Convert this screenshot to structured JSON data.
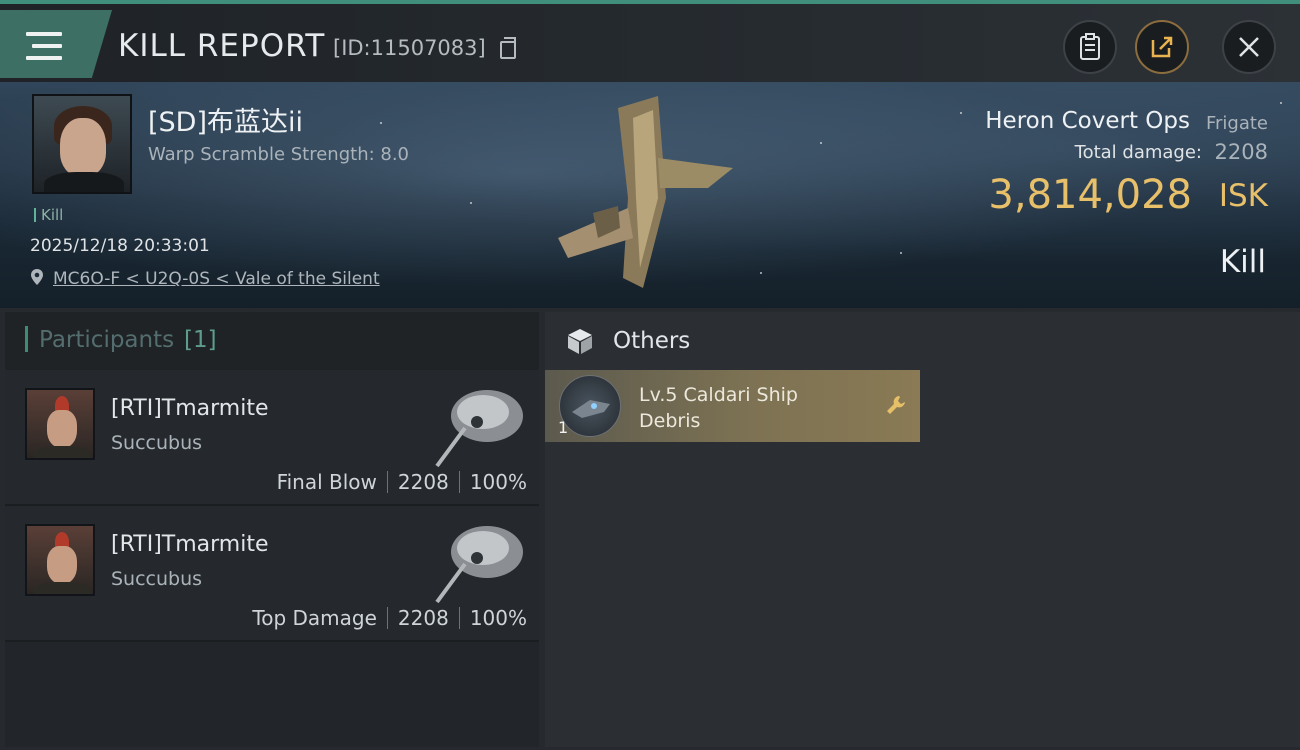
{
  "header": {
    "title": "KILL REPORT",
    "report_id": "[ID:11507083]",
    "menu_icon": "menu-icon",
    "buttons": [
      "clipboard-icon",
      "share-icon",
      "close-icon"
    ]
  },
  "victim": {
    "name": "[SD]布蓝达ii",
    "warp_scramble": "Warp Scramble Strength: 8.0",
    "result_tag": "Kill",
    "datetime": "2025/12/18 20:33:01",
    "location": "MC6O-F < U2Q-0S < Vale of the Silent",
    "ship_name": "Heron Covert Ops",
    "ship_class": "Frigate",
    "total_damage_label": "Total damage:",
    "total_damage_value": "2208",
    "isk_value": "3,814,028",
    "isk_unit": "ISK",
    "result": "Kill"
  },
  "participants": {
    "title": "Participants",
    "count": "[1]",
    "rows": [
      {
        "name": "[RTI]Tmarmite",
        "ship": "Succubus",
        "role": "Final Blow",
        "damage": "2208",
        "percent": "100%"
      },
      {
        "name": "[RTI]Tmarmite",
        "ship": "Succubus",
        "role": "Top Damage",
        "damage": "2208",
        "percent": "100%"
      }
    ]
  },
  "others": {
    "title": "Others",
    "items": [
      {
        "qty": "1",
        "name": "Lv.5 Caldari Ship Debris"
      }
    ]
  },
  "colors": {
    "accent": "#3e8c77",
    "isk": "#e8c06a",
    "item_card": "#7d7253"
  }
}
